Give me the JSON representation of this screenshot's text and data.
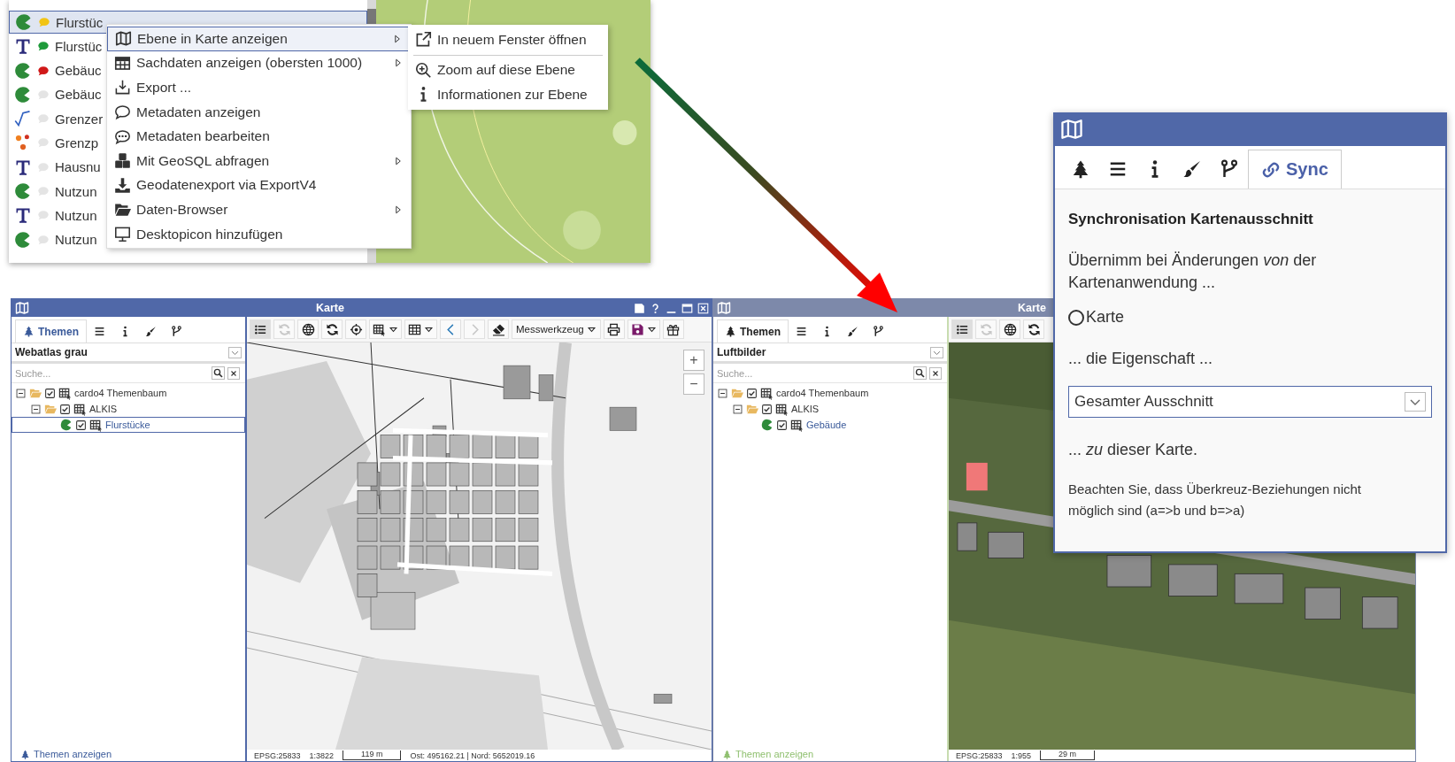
{
  "layer_list": {
    "rows": [
      {
        "label": "Flurstüc",
        "kind": "polygon",
        "color": "#f2c414",
        "selected": true
      },
      {
        "label": "Flurstüc",
        "kind": "text",
        "color": "#1e9a3a",
        "selected": false
      },
      {
        "label": "Gebäuc",
        "kind": "polygon",
        "color": "#d01818",
        "selected": false
      },
      {
        "label": "Gebäuc",
        "kind": "polygon",
        "color": "#e4e4e4",
        "selected": false
      },
      {
        "label": "Grenzer",
        "kind": "line",
        "color": "#e4e4e4",
        "selected": false
      },
      {
        "label": "Grenzp",
        "kind": "points",
        "color": "#e4e4e4",
        "selected": false
      },
      {
        "label": "Hausnu",
        "kind": "text",
        "color": "#e4e4e4",
        "selected": false
      },
      {
        "label": "Nutzun",
        "kind": "polygon",
        "color": "#e4e4e4",
        "selected": false
      },
      {
        "label": "Nutzun",
        "kind": "text",
        "color": "#e4e4e4",
        "selected": false
      },
      {
        "label": "Nutzun",
        "kind": "polygon",
        "color": "#e4e4e4",
        "selected": false
      }
    ]
  },
  "context_menu": {
    "items": [
      {
        "label": "Ebene in Karte anzeigen",
        "submenu": true,
        "selected": true
      },
      {
        "label": "Sachdaten anzeigen (obersten 1000)",
        "submenu": true,
        "selected": false
      },
      {
        "label": "Export ...",
        "submenu": false,
        "selected": false
      },
      {
        "label": "Metadaten anzeigen",
        "submenu": false,
        "selected": false
      },
      {
        "label": "Metadaten bearbeiten",
        "submenu": false,
        "selected": false
      },
      {
        "label": "Mit GeoSQL abfragen",
        "submenu": true,
        "selected": false
      },
      {
        "label": "Geodatenexport via ExportV4",
        "submenu": false,
        "selected": false
      },
      {
        "label": "Daten-Browser",
        "submenu": true,
        "selected": false
      },
      {
        "label": "Desktopicon hinzufügen",
        "submenu": false,
        "selected": false
      }
    ]
  },
  "submenu": {
    "groups": [
      [
        {
          "kind": "window",
          "label": "In neuem Fenster öffnen"
        }
      ],
      [
        {
          "kind": "zoom",
          "label": "Zoom auf diese Ebene"
        },
        {
          "kind": "info",
          "label": "Informationen zur Ebene"
        }
      ]
    ]
  },
  "windows": [
    {
      "title": "Karte",
      "active": true,
      "tabs": [
        {
          "kind": "themes",
          "label": "Themen",
          "selected": true
        },
        {
          "kind": "legend",
          "selected": false
        },
        {
          "kind": "info",
          "selected": false
        },
        {
          "kind": "style",
          "selected": false
        },
        {
          "kind": "branch",
          "selected": false
        }
      ],
      "theme_select": "Webatlas grau",
      "search": {
        "placeholder": "Suche..."
      },
      "tree": [
        {
          "label": "cardo4 Themenbaum",
          "kind": "folder",
          "checked": true,
          "expanded": true,
          "children": [
            {
              "label": "ALKIS",
              "kind": "folder",
              "checked": true,
              "expanded": true,
              "children": [
                {
                  "label": "Flurstücke",
                  "kind": "layer",
                  "checked": true,
                  "active": true
                }
              ]
            }
          ]
        }
      ],
      "footer": "Themen anzeigen",
      "toolbar": [
        {
          "kind": "layers",
          "selected": true
        },
        {
          "kind": "reload",
          "disabled": true
        },
        {
          "kind": "globe",
          "disabled": false
        },
        {
          "kind": "refresh",
          "disabled": false
        },
        {
          "kind": "locate",
          "disabled": false
        },
        {
          "kind": "select-menu",
          "disabled": false
        },
        {
          "kind": "grid-menu",
          "disabled": false
        },
        {
          "kind": "back",
          "disabled": false
        },
        {
          "kind": "forward",
          "disabled": true
        },
        {
          "kind": "eraser",
          "disabled": false
        },
        {
          "kind": "tool",
          "label": "Messwerkzeug"
        },
        {
          "kind": "print",
          "disabled": false
        },
        {
          "kind": "save-menu",
          "disabled": false
        },
        {
          "kind": "gift",
          "disabled": false
        }
      ],
      "map": {
        "kind": "street",
        "zoom_controls": [
          "+",
          "−"
        ]
      },
      "status": {
        "crs": "EPSG:25833",
        "scale": "1:3822",
        "scale_bar": "119 m",
        "coordinates": "Ost: 495162.21 | Nord: 5652019.16"
      }
    },
    {
      "title": "Karte",
      "active": false,
      "tabs": [
        {
          "kind": "themes",
          "label": "Themen",
          "selected": true
        },
        {
          "kind": "legend",
          "selected": false
        },
        {
          "kind": "info",
          "selected": false
        },
        {
          "kind": "style",
          "selected": false
        },
        {
          "kind": "branch",
          "selected": false
        }
      ],
      "theme_select": "Luftbilder",
      "search": {
        "placeholder": "Suche..."
      },
      "tree": [
        {
          "label": "cardo4 Themenbaum",
          "kind": "folder",
          "checked": true,
          "expanded": true,
          "children": [
            {
              "label": "ALKIS",
              "kind": "folder",
              "checked": true,
              "expanded": true,
              "children": [
                {
                  "label": "Gebäude",
                  "kind": "layer",
                  "checked": true,
                  "active": false
                }
              ]
            }
          ]
        }
      ],
      "footer": "Themen anzeigen",
      "toolbar": [
        {
          "kind": "layers",
          "selected": true
        },
        {
          "kind": "reload",
          "disabled": true
        },
        {
          "kind": "globe",
          "disabled": false
        },
        {
          "kind": "refresh",
          "disabled": false
        }
      ],
      "map": {
        "kind": "aerial"
      },
      "status": {
        "crs": "EPSG:25833",
        "scale": "1:955",
        "scale_bar": "29 m"
      }
    }
  ],
  "sync_panel": {
    "tabs": [
      {
        "kind": "themes",
        "selected": false
      },
      {
        "kind": "legend",
        "selected": false
      },
      {
        "kind": "info",
        "selected": false
      },
      {
        "kind": "style",
        "selected": false
      },
      {
        "kind": "branch",
        "selected": false
      },
      {
        "kind": "sync",
        "label": "Sync",
        "selected": true
      }
    ],
    "heading": "Synchronisation Kartenausschnitt",
    "intro": "Übernimm bei Änderungen *von* der Kartenanwendung ...",
    "radio": {
      "label": "Karte",
      "checked": false
    },
    "property_label": "... die Eigenschaft ...",
    "property_select": "Gesamter Ausschnitt",
    "target_label": "... *zu* dieser Karte.",
    "note": "Beachten Sie, dass Überkreuz-Beziehungen nicht möglich sind (a=>b und b=>a)"
  }
}
